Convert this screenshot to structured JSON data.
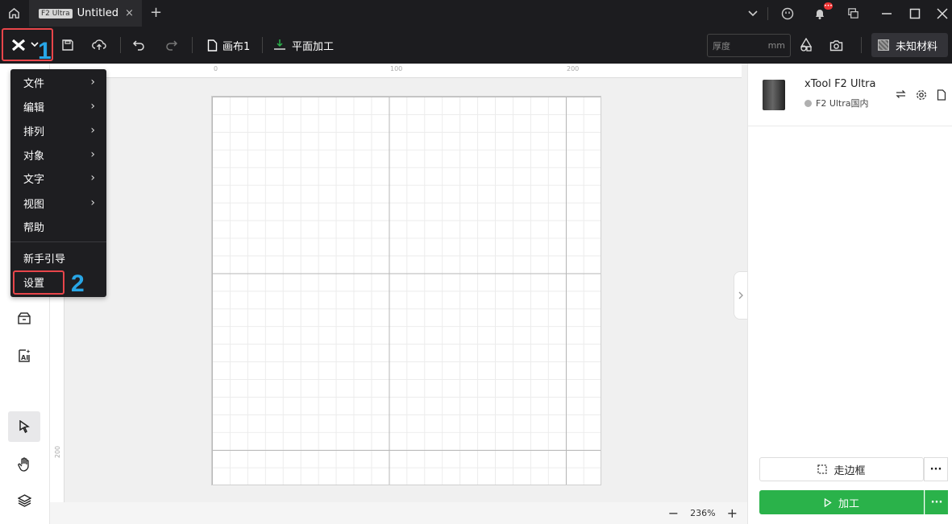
{
  "titlebar": {
    "tab_badge": "F2 Ultra",
    "tab_title": "Untitled",
    "tab_close": "×",
    "tab_add": "+",
    "notification_count": "•••"
  },
  "toolbar": {
    "canvas_label": "画布1",
    "mode_label": "平面加工",
    "thickness_placeholder": "厚度",
    "thickness_unit": "mm",
    "material_label": "未知材料"
  },
  "annotations": {
    "step1": "1",
    "step2": "2"
  },
  "menu": {
    "items": [
      {
        "label": "文件",
        "submenu": true
      },
      {
        "label": "编辑",
        "submenu": true
      },
      {
        "label": "排列",
        "submenu": true
      },
      {
        "label": "对象",
        "submenu": true
      },
      {
        "label": "文字",
        "submenu": true
      },
      {
        "label": "视图",
        "submenu": true
      },
      {
        "label": "帮助",
        "submenu": false
      }
    ],
    "guide_label": "新手引导",
    "settings_label": "设置",
    "arrow": "›"
  },
  "rulers": {
    "top": [
      "0",
      "100",
      "200"
    ],
    "left": [
      "200"
    ]
  },
  "zoom": {
    "minus": "−",
    "value": "236%",
    "plus": "+"
  },
  "device": {
    "name": "xTool F2 Ultra",
    "status": "F2 Ultra国内"
  },
  "actions": {
    "frame_label": "走边框",
    "process_label": "加工",
    "more": "···"
  },
  "colors": {
    "accent_green": "#2ab24a",
    "highlight_red": "#e8454a",
    "step_blue": "#28a6e6"
  }
}
